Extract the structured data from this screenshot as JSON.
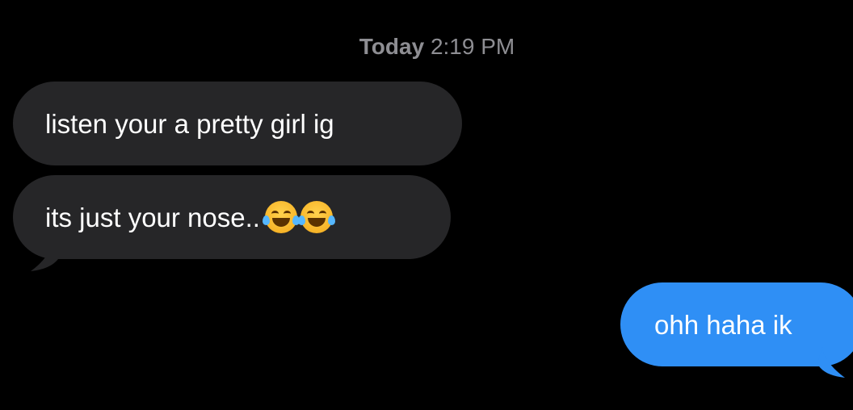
{
  "conversation": {
    "timestamp_day": "Today",
    "timestamp_time": "2:19 PM",
    "messages": [
      {
        "sender": "other",
        "text": "listen your a pretty girl ig"
      },
      {
        "sender": "other",
        "text": "its just your nose..",
        "emojis": [
          "face-with-tears-of-joy-emoji",
          "face-with-tears-of-joy-emoji"
        ]
      },
      {
        "sender": "me",
        "text": "ohh haha ik"
      }
    ]
  },
  "colors": {
    "background": "#000000",
    "incoming_bubble": "#262628",
    "outgoing_bubble": "#2f8ff5",
    "timestamp": "#8e8e93"
  }
}
